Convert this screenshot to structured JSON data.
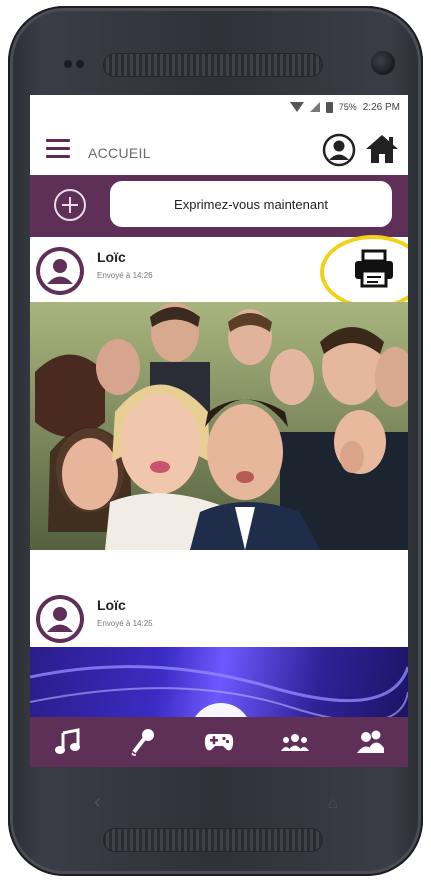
{
  "status_bar": {
    "battery": "75%",
    "time": "2:26 PM"
  },
  "app_bar": {
    "title": "ACCUEIL"
  },
  "compose": {
    "placeholder": "Exprimez-vous maintenant"
  },
  "posts": [
    {
      "author": "Loïc",
      "sent": "Envoyé à 14:26"
    },
    {
      "author": "Loïc",
      "sent": "Envoyé à 14:25"
    }
  ],
  "bottom_nav": [
    {
      "icon": "music-note-icon"
    },
    {
      "icon": "microphone-icon"
    },
    {
      "icon": "gamepad-icon"
    },
    {
      "icon": "group-icon"
    },
    {
      "icon": "couple-icon"
    }
  ],
  "colors": {
    "brand": "#5e2f57",
    "highlight": "#f2d11a"
  }
}
